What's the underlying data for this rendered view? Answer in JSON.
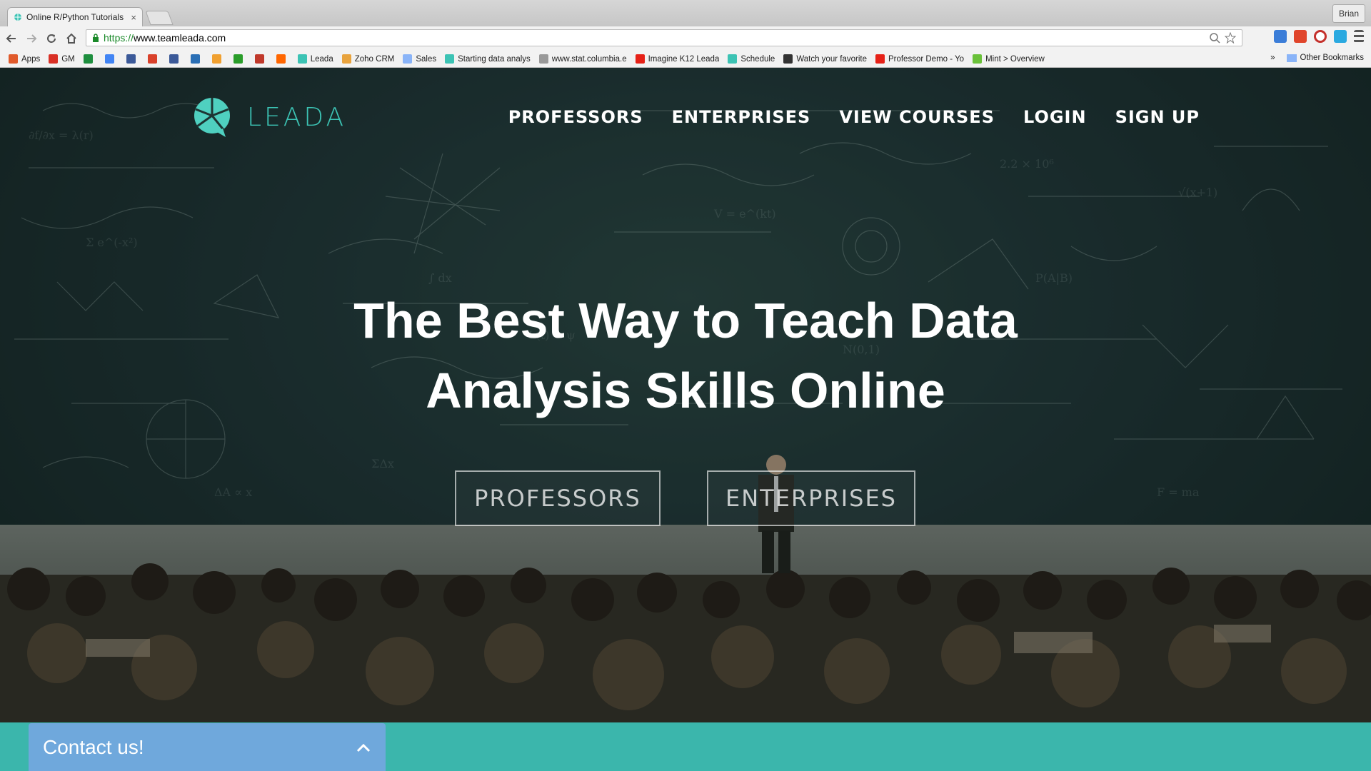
{
  "browser": {
    "tab_title": "Online R/Python Tutorials",
    "tab_close": "×",
    "profile_name": "Brian",
    "url_scheme": "https://",
    "url_host": "www.teamleada.com"
  },
  "bookmarks": {
    "items": [
      {
        "label": "Apps",
        "icon": "apps-grid-icon",
        "color": "#e05a2b"
      },
      {
        "label": "GM",
        "icon": "gmail-icon",
        "color": "#d93025"
      },
      {
        "label": "",
        "icon": "green-sheet-icon",
        "color": "#1e8e3e"
      },
      {
        "label": "",
        "icon": "calendar-icon",
        "color": "#4285f4"
      },
      {
        "label": "",
        "icon": "doc-icon",
        "color": "#3b5998"
      },
      {
        "label": "",
        "icon": "red-app-icon",
        "color": "#d9412b"
      },
      {
        "label": "",
        "icon": "facebook-icon",
        "color": "#3b5998"
      },
      {
        "label": "",
        "icon": "blue-app-icon",
        "color": "#2a6fb5"
      },
      {
        "label": "",
        "icon": "flower-icon",
        "color": "#f0a030"
      },
      {
        "label": "",
        "icon": "tc-icon",
        "color": "#2a9d2a"
      },
      {
        "label": "",
        "icon": "vb-icon",
        "color": "#c0392b"
      },
      {
        "label": "",
        "icon": "ycombinator-icon",
        "color": "#ff6600"
      },
      {
        "label": "Leada",
        "icon": "leada-icon",
        "color": "#3cc3b4"
      },
      {
        "label": "Zoho CRM",
        "icon": "zoho-icon",
        "color": "#e8a33d"
      },
      {
        "label": "Sales",
        "icon": "folder-icon",
        "color": "#8ab4f8"
      },
      {
        "label": "Starting data analys",
        "icon": "leada-icon",
        "color": "#3cc3b4"
      },
      {
        "label": "www.stat.columbia.e",
        "icon": "page-icon",
        "color": "#999999"
      },
      {
        "label": "Imagine K12 Leada",
        "icon": "youtube-icon",
        "color": "#e62117"
      },
      {
        "label": "Schedule",
        "icon": "leada-icon",
        "color": "#3cc3b4"
      },
      {
        "label": "Watch your favorite",
        "icon": "film-icon",
        "color": "#333333"
      },
      {
        "label": "Professor Demo - Yo",
        "icon": "youtube-icon",
        "color": "#e62117"
      },
      {
        "label": "Mint > Overview",
        "icon": "mint-icon",
        "color": "#6ac13a"
      }
    ],
    "overflow": "»",
    "other": "Other Bookmarks"
  },
  "site": {
    "brand": "LEADA",
    "brand_color": "#3cc3b4",
    "nav": [
      "PROFESSORS",
      "ENTERPRISES",
      "VIEW COURSES",
      "LOGIN",
      "SIGN UP"
    ],
    "headline_line1": "The Best Way to Teach Data",
    "headline_line2": "Analysis Skills Online",
    "cta_professors": "PROFESSORS",
    "cta_enterprises": "ENTERPRISES"
  },
  "contact": {
    "label": "Contact us!",
    "bar_color": "#3bb6ac",
    "panel_color": "#6fa8dc"
  }
}
